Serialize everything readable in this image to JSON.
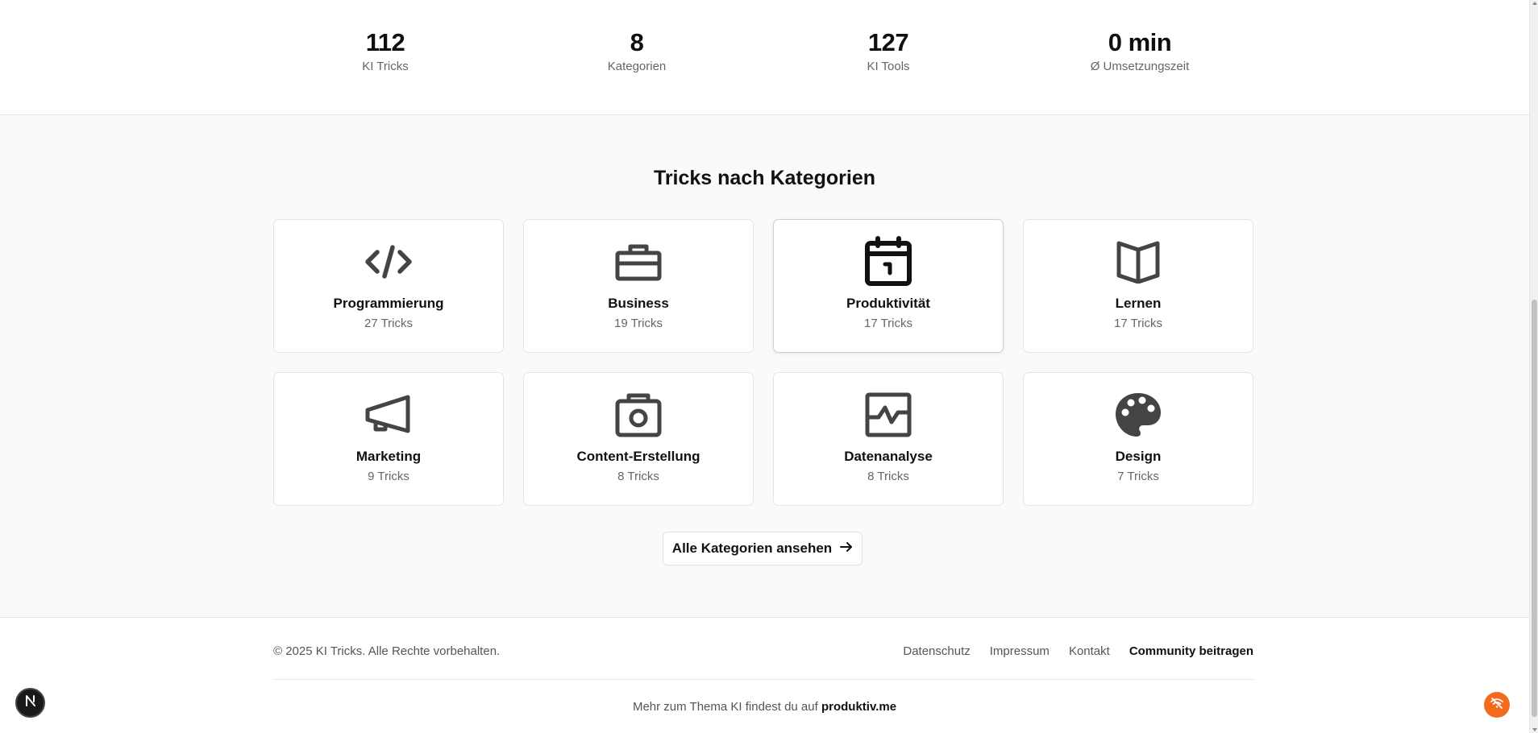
{
  "stats": [
    {
      "value": "112",
      "label": "KI Tricks"
    },
    {
      "value": "8",
      "label": "Kategorien"
    },
    {
      "value": "127",
      "label": "KI Tools"
    },
    {
      "value": "0 min",
      "label": "Ø Umsetzungszeit"
    }
  ],
  "categories": {
    "title": "Tricks nach Kategorien",
    "items": [
      {
        "name": "Programmierung",
        "count": "27 Tricks",
        "icon": "code-icon"
      },
      {
        "name": "Business",
        "count": "19 Tricks",
        "icon": "briefcase-icon"
      },
      {
        "name": "Produktivität",
        "count": "17 Tricks",
        "icon": "calendar-icon"
      },
      {
        "name": "Lernen",
        "count": "17 Tricks",
        "icon": "book-open-icon"
      },
      {
        "name": "Marketing",
        "count": "9 Tricks",
        "icon": "megaphone-icon"
      },
      {
        "name": "Content-Erstellung",
        "count": "8 Tricks",
        "icon": "camera-icon"
      },
      {
        "name": "Datenanalyse",
        "count": "8 Tricks",
        "icon": "chart-icon"
      },
      {
        "name": "Design",
        "count": "7 Tricks",
        "icon": "palette-icon"
      }
    ],
    "all_button": "Alle Kategorien ansehen"
  },
  "footer": {
    "copyright": "© 2025 KI Tricks. Alle Rechte vorbehalten.",
    "links": [
      "Datenschutz",
      "Impressum",
      "Kontakt",
      "Community beitragen"
    ],
    "more_text": "Mehr zum Thema KI findest du auf",
    "more_brand": "produktiv.me"
  },
  "colors": {
    "icon": "#444444",
    "accent_fab": "#f26b1d",
    "section_bg": "#fafafa"
  }
}
